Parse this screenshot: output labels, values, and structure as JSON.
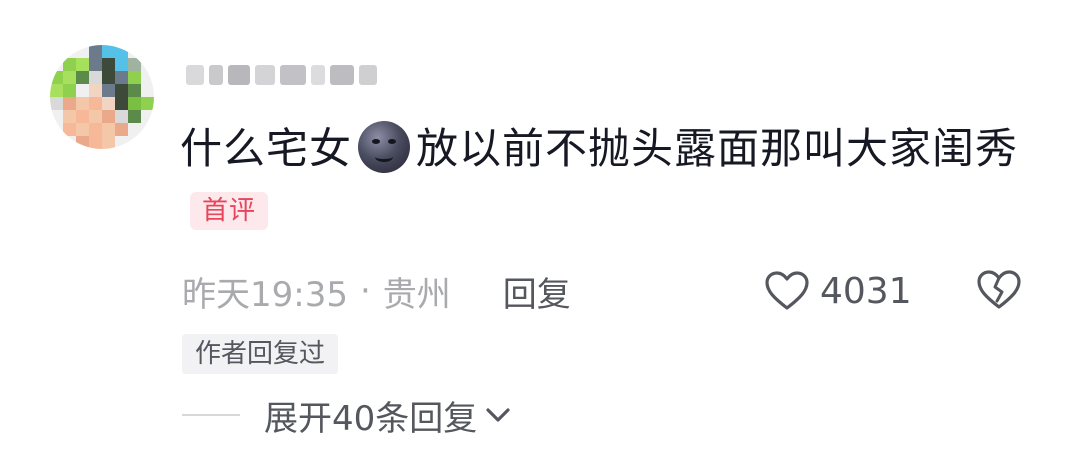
{
  "comment": {
    "username_pixelated": true,
    "text_before_emoji": "什么宅女",
    "emoji": "new-moon-face-emoji",
    "text_after_emoji": "放以前不抛头露面那叫大家闺秀",
    "first_comment_badge": "首评"
  },
  "meta": {
    "time": "昨天19:35",
    "separator": "·",
    "location": "贵州",
    "reply_label": "回复"
  },
  "likes": {
    "count": "4031"
  },
  "author_badge": "作者回复过",
  "expand": {
    "label": "展开40条回复"
  },
  "colors": {
    "badge_pink": "#e8455c",
    "badge_pink_bg": "#fde8ec",
    "muted_text": "#a9aaae",
    "icon_gray": "#55575e"
  }
}
